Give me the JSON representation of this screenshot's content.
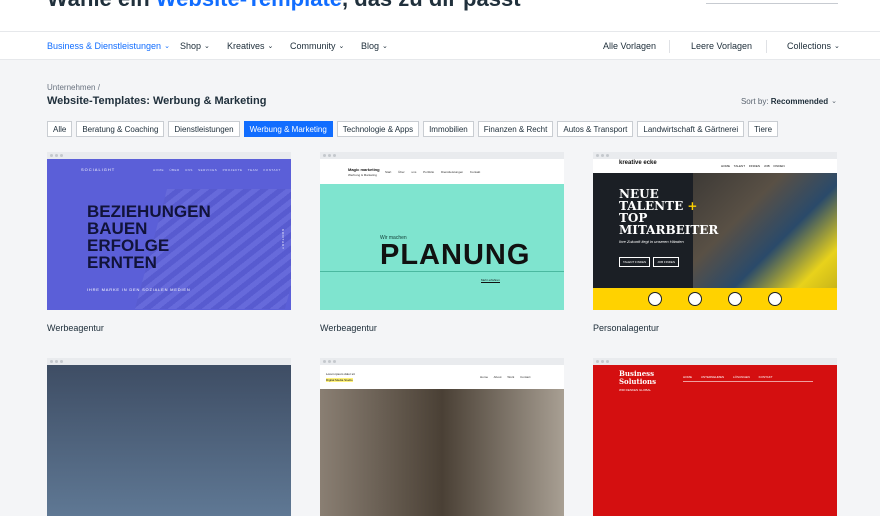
{
  "hero": {
    "title_pre": "Wähle ein ",
    "title_accent": "Website-Template",
    "title_post": ", das zu dir passt"
  },
  "nav": {
    "left": [
      {
        "label": "Business & Dienstleistungen",
        "active": true
      },
      {
        "label": "Shop"
      },
      {
        "label": "Kreatives"
      },
      {
        "label": "Community"
      },
      {
        "label": "Blog"
      }
    ],
    "right": [
      {
        "label": "Alle Vorlagen"
      },
      {
        "label": "Leere Vorlagen"
      },
      {
        "label": "Collections"
      }
    ]
  },
  "breadcrumb": "Unternehmen /",
  "page_title": "Website-Templates: Werbung & Marketing",
  "sort": {
    "prefix": "Sort by: ",
    "value": "Recommended"
  },
  "filters": [
    {
      "label": "Alle"
    },
    {
      "label": "Beratung & Coaching"
    },
    {
      "label": "Dienstleistungen"
    },
    {
      "label": "Werbung & Marketing",
      "active": true
    },
    {
      "label": "Technologie & Apps"
    },
    {
      "label": "Immobilien"
    },
    {
      "label": "Finanzen & Recht"
    },
    {
      "label": "Autos & Transport"
    },
    {
      "label": "Landwirtschaft & Gärtnerei"
    },
    {
      "label": "Tiere"
    }
  ],
  "cards": [
    {
      "label": "Werbeagentur",
      "brand": "SOCIALIGHT",
      "menu": "HOME ÜBER UNS SERVICES PROJEKTE TEAM KONTAKT",
      "headline": [
        "BEZIEHUNGEN",
        "BAUEN",
        "ERFOLGE",
        "ERNTEN"
      ],
      "sub": "IHRE MARKE IN DEN SOZIALEN MEDIEN",
      "vertical": "KONTAKT"
    },
    {
      "label": "Werbeagentur",
      "brand": "Magic marketing",
      "brand_sub": "Werbung & Marketing",
      "menu": "Start Über uns Portfolio Dienstleistungen Kontakt",
      "small": "Wir machen",
      "big": "PLANUNG",
      "link": "Mehr erfahren"
    },
    {
      "label": "Personalagentur",
      "brand": "kreative ecke",
      "menu": "HOME TALENT FINDEN JOB FINDEN",
      "headline": [
        "NEUE",
        "TALENTE",
        "TOP",
        "MITARBEITER"
      ],
      "plus": "+",
      "sub": "Ihre Zukunft liegt in unseren Händen",
      "btn1": "TALENT FINDEN",
      "btn2": "JOB FINDEN"
    },
    {
      "label": ""
    },
    {
      "label": "",
      "title": "Lorem ipsum dolor sit",
      "highlight": "Digital Media Studio",
      "menu": "Home About Work Contact"
    },
    {
      "label": "",
      "brand": [
        "Business",
        "Solutions"
      ],
      "sub": "WIR DENKEN GLOBAL",
      "menu": "HOME UNTERNEHMEN LÖSUNGEN KONTAKT"
    }
  ]
}
